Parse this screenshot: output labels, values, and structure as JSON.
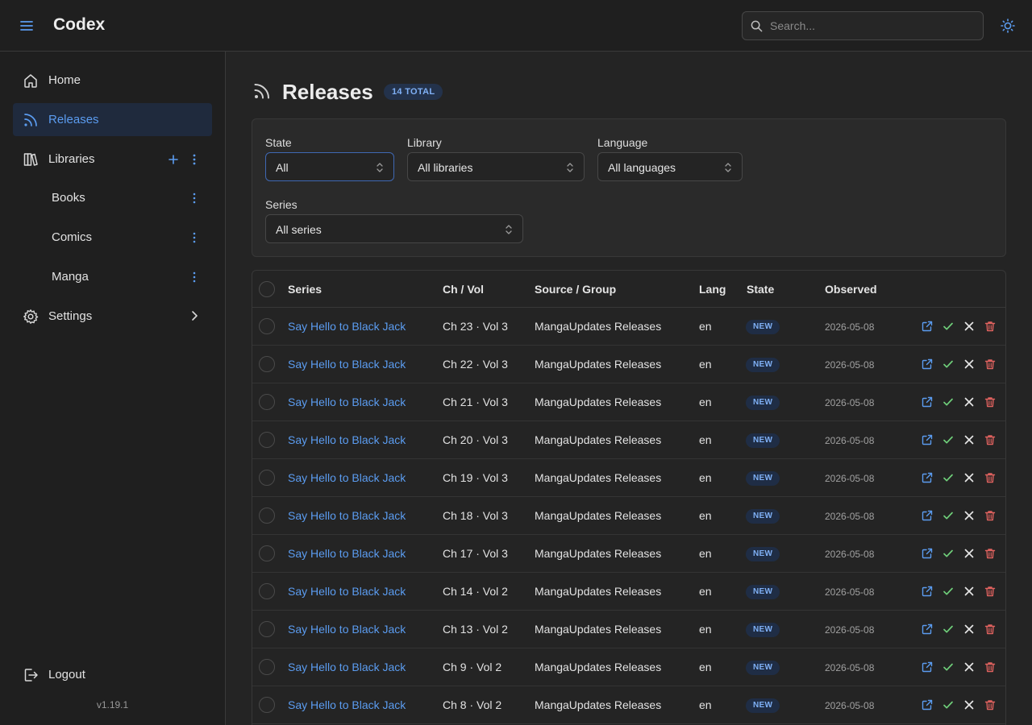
{
  "header": {
    "title": "Codex",
    "search_placeholder": "Search...",
    "theme_icon": "sun-icon",
    "menu_icon": "hamburger-icon"
  },
  "sidebar": {
    "items": [
      {
        "label": "Home",
        "icon": "home-icon"
      },
      {
        "label": "Releases",
        "icon": "rss-icon",
        "active": true
      },
      {
        "label": "Libraries",
        "icon": "books-icon"
      },
      {
        "label": "Books"
      },
      {
        "label": "Comics"
      },
      {
        "label": "Manga"
      },
      {
        "label": "Settings",
        "icon": "gear-icon"
      }
    ],
    "logout": "Logout",
    "version": "v1.19.1"
  },
  "main": {
    "title": "Releases",
    "total_badge": "14 TOTAL",
    "filters": {
      "state": {
        "label": "State",
        "value": "All"
      },
      "library": {
        "label": "Library",
        "value": "All libraries"
      },
      "language": {
        "label": "Language",
        "value": "All languages"
      },
      "series": {
        "label": "Series",
        "value": "All series"
      }
    },
    "table": {
      "columns": [
        "Series",
        "Ch / Vol",
        "Source / Group",
        "Lang",
        "State",
        "Observed"
      ],
      "rows": [
        {
          "series": "Say Hello to Black Jack",
          "chvol": "Ch 23 · Vol 3",
          "source": "MangaUpdates Releases",
          "lang": "en",
          "state": "NEW",
          "observed": "2026-05-08"
        },
        {
          "series": "Say Hello to Black Jack",
          "chvol": "Ch 22 · Vol 3",
          "source": "MangaUpdates Releases",
          "lang": "en",
          "state": "NEW",
          "observed": "2026-05-08"
        },
        {
          "series": "Say Hello to Black Jack",
          "chvol": "Ch 21 · Vol 3",
          "source": "MangaUpdates Releases",
          "lang": "en",
          "state": "NEW",
          "observed": "2026-05-08"
        },
        {
          "series": "Say Hello to Black Jack",
          "chvol": "Ch 20 · Vol 3",
          "source": "MangaUpdates Releases",
          "lang": "en",
          "state": "NEW",
          "observed": "2026-05-08"
        },
        {
          "series": "Say Hello to Black Jack",
          "chvol": "Ch 19 · Vol 3",
          "source": "MangaUpdates Releases",
          "lang": "en",
          "state": "NEW",
          "observed": "2026-05-08"
        },
        {
          "series": "Say Hello to Black Jack",
          "chvol": "Ch 18 · Vol 3",
          "source": "MangaUpdates Releases",
          "lang": "en",
          "state": "NEW",
          "observed": "2026-05-08"
        },
        {
          "series": "Say Hello to Black Jack",
          "chvol": "Ch 17 · Vol 3",
          "source": "MangaUpdates Releases",
          "lang": "en",
          "state": "NEW",
          "observed": "2026-05-08"
        },
        {
          "series": "Say Hello to Black Jack",
          "chvol": "Ch 14 · Vol 2",
          "source": "MangaUpdates Releases",
          "lang": "en",
          "state": "NEW",
          "observed": "2026-05-08"
        },
        {
          "series": "Say Hello to Black Jack",
          "chvol": "Ch 13 · Vol 2",
          "source": "MangaUpdates Releases",
          "lang": "en",
          "state": "NEW",
          "observed": "2026-05-08"
        },
        {
          "series": "Say Hello to Black Jack",
          "chvol": "Ch 9 · Vol 2",
          "source": "MangaUpdates Releases",
          "lang": "en",
          "state": "NEW",
          "observed": "2026-05-08"
        },
        {
          "series": "Say Hello to Black Jack",
          "chvol": "Ch 8 · Vol 2",
          "source": "MangaUpdates Releases",
          "lang": "en",
          "state": "NEW",
          "observed": "2026-05-08"
        }
      ],
      "row_actions": [
        "external-link-icon",
        "check-icon",
        "close-icon",
        "trash-icon"
      ]
    }
  },
  "colors": {
    "accent": "#5b9cf0",
    "check": "#6fcf7a",
    "danger": "#e0625f",
    "badge_bg": "#1f2d45"
  }
}
